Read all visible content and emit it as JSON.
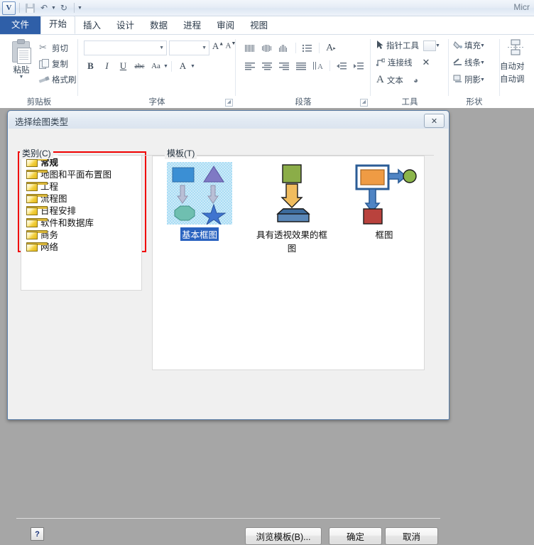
{
  "window": {
    "app_title": "Micr",
    "logo": "V"
  },
  "quick_access": {
    "items": [
      {
        "name": "save-icon",
        "label": "保存"
      },
      {
        "name": "undo-icon",
        "label": "撤消"
      },
      {
        "name": "redo-icon",
        "label": "恢复"
      },
      {
        "name": "customize-qat-icon",
        "label": "自定义快速访问工具栏"
      }
    ]
  },
  "ribbon": {
    "tabs": [
      {
        "label": "文件",
        "kind": "file"
      },
      {
        "label": "开始",
        "kind": "active"
      },
      {
        "label": "插入",
        "kind": "normal"
      },
      {
        "label": "设计",
        "kind": "normal"
      },
      {
        "label": "数据",
        "kind": "normal"
      },
      {
        "label": "进程",
        "kind": "normal"
      },
      {
        "label": "审阅",
        "kind": "normal"
      },
      {
        "label": "视图",
        "kind": "normal"
      }
    ],
    "groups": {
      "clipboard": {
        "label": "剪贴板",
        "paste": "粘贴",
        "cut": "剪切",
        "copy": "复制",
        "format_painter": "格式刷"
      },
      "font": {
        "label": "字体",
        "font_name_value": "",
        "font_size_value": "",
        "grow_font": "A",
        "shrink_font": "A",
        "bold": "B",
        "italic": "I",
        "underline": "U",
        "strikethrough": "abc",
        "change_case": "Aa",
        "font_color": "A"
      },
      "paragraph": {
        "label": "段落"
      },
      "tools": {
        "label": "工具",
        "pointer_tool": "指针工具",
        "connector": "连接线",
        "text": "文本"
      },
      "shapes": {
        "label": "形状",
        "fill": "填充",
        "line": "线条",
        "shadow": "阴影"
      },
      "arrange": {
        "line1": "自动对",
        "line2": "自动调"
      }
    }
  },
  "dialog": {
    "title": "选择绘图类型",
    "close_label": "✕",
    "category": {
      "legend": "类别(C)",
      "items": [
        {
          "label": "常规",
          "selected": true
        },
        {
          "label": "地图和平面布置图",
          "selected": false
        },
        {
          "label": "工程",
          "selected": false
        },
        {
          "label": "流程图",
          "selected": false
        },
        {
          "label": "日程安排",
          "selected": false
        },
        {
          "label": "软件和数据库",
          "selected": false
        },
        {
          "label": "商务",
          "selected": false
        },
        {
          "label": "网络",
          "selected": false
        }
      ]
    },
    "templates": {
      "legend": "模板(T)",
      "items": [
        {
          "label": "基本框图",
          "selected": true
        },
        {
          "label": "具有透视效果的框图",
          "selected": false
        },
        {
          "label": "框图",
          "selected": false
        }
      ]
    },
    "footer": {
      "help": "?",
      "browse": "浏览模板(B)...",
      "ok": "确定",
      "cancel": "取消"
    }
  },
  "colors": {
    "file_tab": "#2f5fa8",
    "highlight_red": "#f00000",
    "selection_blue": "#2a63c0",
    "desktop_gray": "#a6a6a6"
  }
}
